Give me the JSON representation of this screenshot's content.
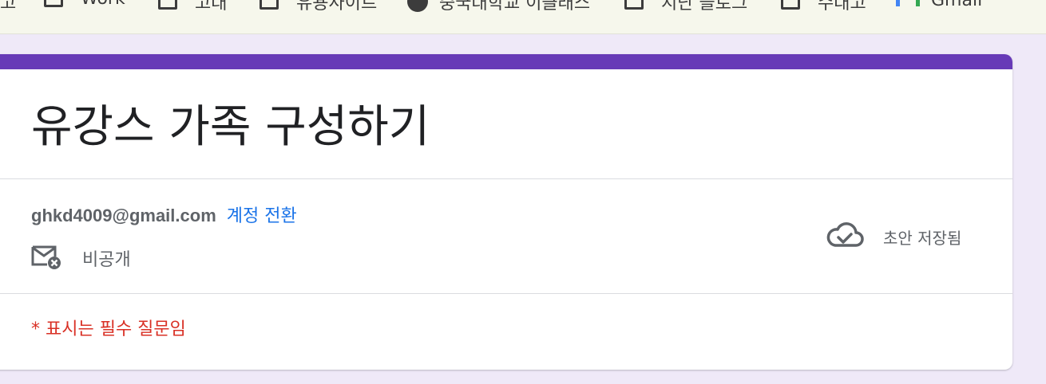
{
  "bookmarks": [
    {
      "label": "고",
      "icon": "folder-icon"
    },
    {
      "label": "Work",
      "icon": "folder-icon"
    },
    {
      "label": "고대",
      "icon": "folder-icon"
    },
    {
      "label": "유용사이트",
      "icon": "folder-icon"
    },
    {
      "label": "중국대학교 이클래스",
      "icon": "globe-icon"
    },
    {
      "label": "지난 블로그",
      "icon": "folder-icon"
    },
    {
      "label": "수대고",
      "icon": "folder-icon"
    },
    {
      "label": "Gmail",
      "icon": "gmail-icon"
    }
  ],
  "form": {
    "title": "유강스 가족 구성하기",
    "accent_color": "#673ab7",
    "account_email": "ghkd4009@gmail.com",
    "switch_account": "계정 전환",
    "visibility": "비공개",
    "saved_status": "초안 저장됨",
    "required_notice": "* 표시는 필수 질문임"
  }
}
